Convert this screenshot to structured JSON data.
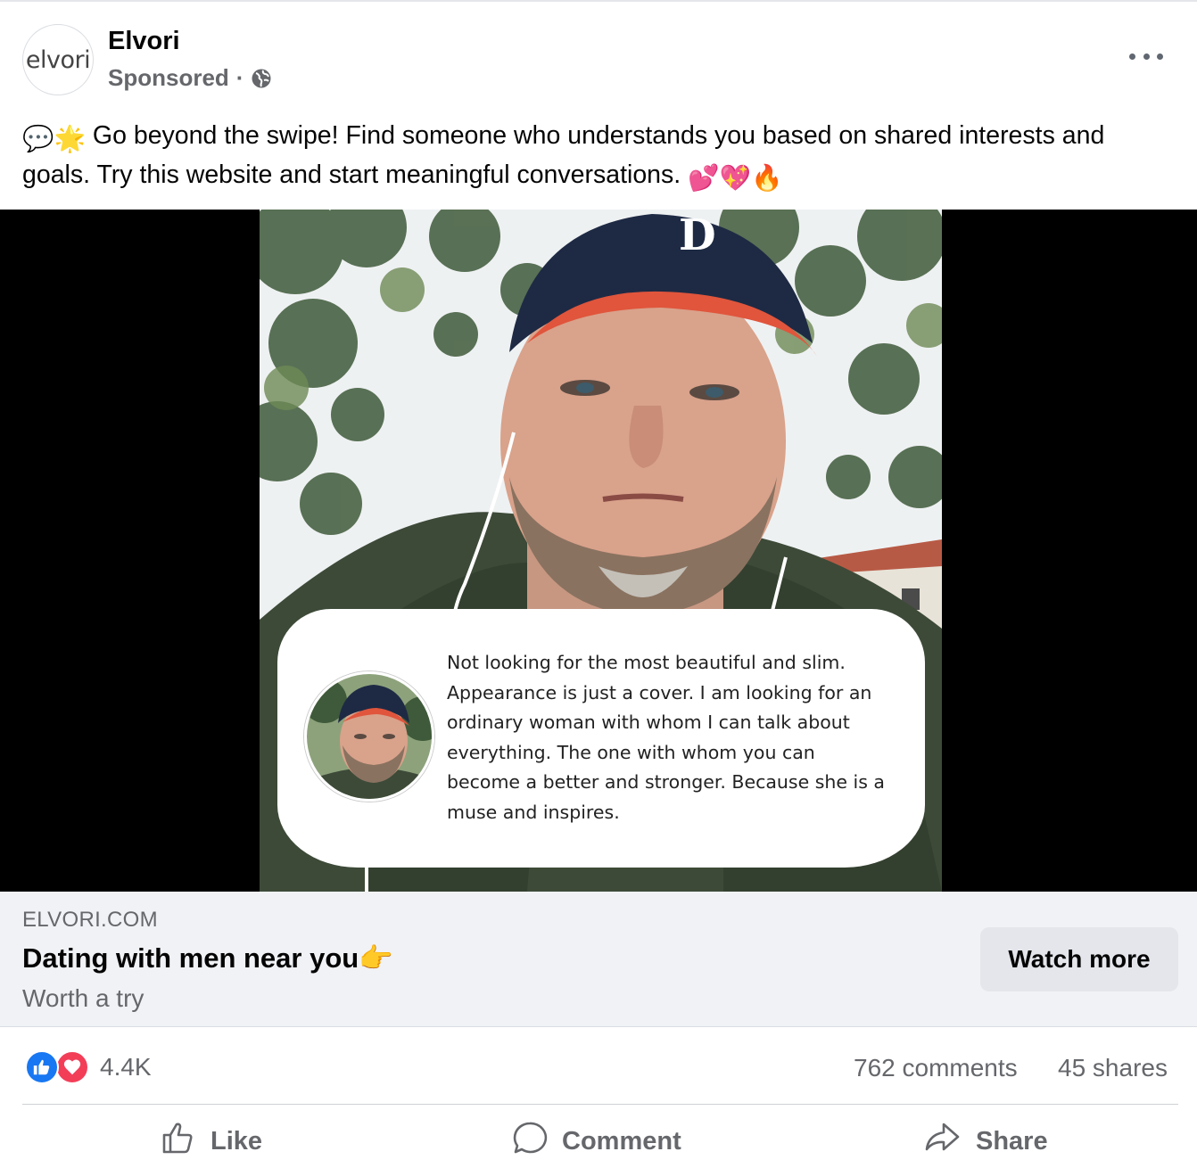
{
  "post": {
    "avatar_text": "elvori",
    "page_name": "Elvori",
    "sponsored_label": "Sponsored",
    "separator": "·",
    "caption_emoji_lead": "💬🌟",
    "caption_text": " Go beyond the swipe! Find someone who understands you based on shared interests and goals. Try this website and start meaningful conversations. ",
    "caption_emoji_tail": "💕💖🔥"
  },
  "media": {
    "quote": "Not looking for the most beautiful and slim. Appearance is just a cover.  I am looking for an ordinary woman with whom I can talk about everything. The one with whom you can become a better and stronger. Because she is a muse and inspires."
  },
  "link": {
    "domain": "ELVORI.COM",
    "headline": "Dating with men near you",
    "headline_emoji": "👉",
    "subtitle": "Worth a try",
    "cta_label": "Watch more"
  },
  "stats": {
    "reaction_count": "4.4K",
    "comments": "762 comments",
    "shares": "45 shares"
  },
  "actions": {
    "like": "Like",
    "comment": "Comment",
    "share": "Share"
  },
  "colors": {
    "like_blue": "#1877f2",
    "love_red": "#f33e58",
    "secondary_text": "#65676b",
    "link_bar_bg": "#f0f2f5"
  },
  "icons": [
    "globe-icon",
    "more-options-icon",
    "like-reaction-icon",
    "love-reaction-icon",
    "like-icon",
    "comment-icon",
    "share-icon"
  ]
}
